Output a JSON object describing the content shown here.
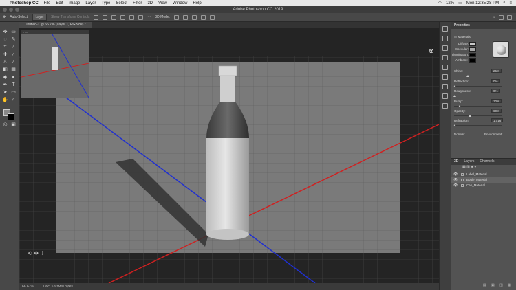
{
  "mac_menubar": {
    "apple_icon": "apple-logo-icon",
    "items": [
      "Photoshop CC",
      "File",
      "Edit",
      "Image",
      "Layer",
      "Type",
      "Select",
      "Filter",
      "3D",
      "View",
      "Window",
      "Help"
    ],
    "battery": "12%",
    "clock": "Mon 12:35:28 PM"
  },
  "titlebar": {
    "title": "Adobe Photoshop CC 2019"
  },
  "options_bar": {
    "auto_select_label": "Auto-Select:",
    "auto_select_value": "Layer",
    "show_transform": "Show Transform Controls",
    "mode_label": "3D Mode:"
  },
  "document": {
    "tab_label": "Untitled-1 @ 66.7% (Layer 1, RGB/8#) *"
  },
  "status": {
    "zoom": "66.67%",
    "doc": "Doc: 5.93M/0 bytes"
  },
  "properties": {
    "tab": "Properties",
    "section": "Materials",
    "diffuse": "Diffuse:",
    "specular": "Specular:",
    "illumination": "Illumination:",
    "ambient": "Ambient:",
    "shine_label": "Shine:",
    "shine": "25%",
    "reflection_label": "Reflection:",
    "reflection": "0%",
    "roughness_label": "Roughness:",
    "roughness": "0%",
    "bump_label": "Bump:",
    "bump": "10%",
    "opacity_label": "Opacity:",
    "opacity": "60%",
    "refraction_label": "Refraction:",
    "refraction": "1.016",
    "normal_label": "Normal:",
    "environment_label": "Environment:"
  },
  "layers_panel": {
    "tabs": [
      "3D",
      "Layers",
      "Channels"
    ],
    "rows": [
      "Label_Material",
      "Bottle_Material",
      "Cap_Material"
    ]
  },
  "colors": {
    "red_axis": "#d02020",
    "blue_axis": "#2030d0",
    "ground": "#7a7a7a"
  }
}
